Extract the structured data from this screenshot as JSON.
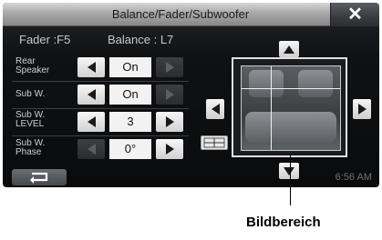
{
  "window": {
    "title": "Balance/Fader/Subwoofer",
    "close_symbol": "✕"
  },
  "status": {
    "fader": "Fader :F5",
    "balance": "Balance : L7"
  },
  "rows": [
    {
      "label": "Rear\nSpeaker",
      "value": "On",
      "left_enabled": true,
      "right_enabled": false
    },
    {
      "label": "Sub W.",
      "value": "On",
      "left_enabled": true,
      "right_enabled": false
    },
    {
      "label": "Sub W.\nLEVEL",
      "value": "3",
      "left_enabled": true,
      "right_enabled": true
    },
    {
      "label": "Sub W.\nPhase",
      "value": "0°",
      "left_enabled": false,
      "right_enabled": true
    }
  ],
  "icons": {
    "close": "close-icon",
    "back": "back-arrow-icon",
    "left": "arrow-left-icon",
    "right": "arrow-right-icon",
    "up": "arrow-up-icon",
    "down": "arrow-down-icon",
    "center": "center-position-icon"
  },
  "clock": "6:56 AM",
  "callout": {
    "label": "Bildbereich"
  },
  "colors": {
    "accent": "#f2f2f2",
    "background": "#0a0b0c"
  }
}
